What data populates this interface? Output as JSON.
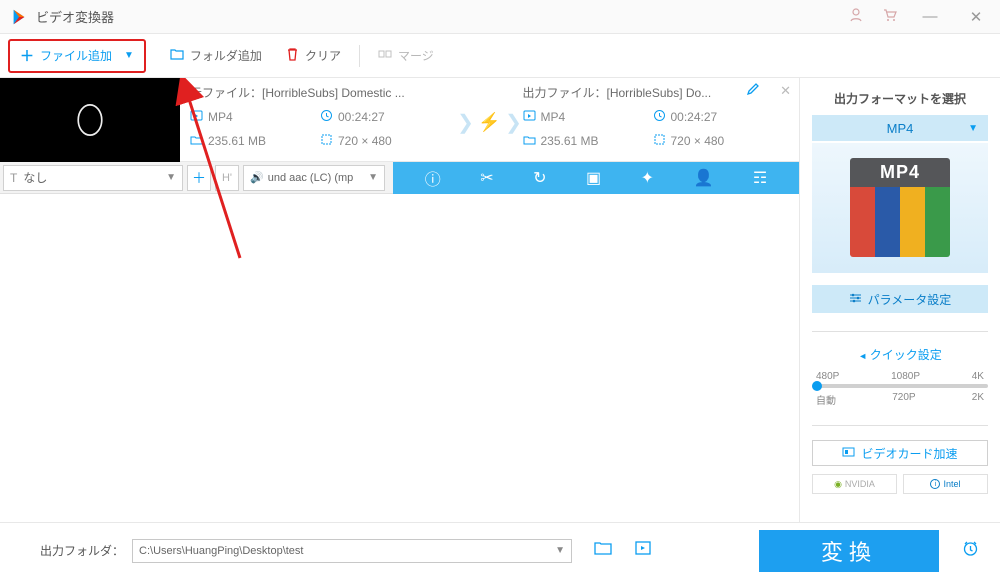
{
  "app": {
    "title": "ビデオ変換器"
  },
  "toolbar": {
    "add_file": "ファイル追加",
    "add_folder": "フォルダ追加",
    "clear": "クリア",
    "merge": "マージ"
  },
  "file": {
    "src_label": "元ファイル：[HorribleSubs] Domestic ...",
    "dst_label": "出力ファイル：[HorribleSubs] Do...",
    "src": {
      "format": "MP4",
      "duration": "00:24:27",
      "size": "235.61 MB",
      "resolution": "720 × 480"
    },
    "dst": {
      "format": "MP4",
      "duration": "00:24:27",
      "size": "235.61 MB",
      "resolution": "720 × 480"
    }
  },
  "options": {
    "subtitle": "なし",
    "audio": "und aac (LC) (mp"
  },
  "right": {
    "title": "出力フォーマットを選択",
    "format": "MP4",
    "format_badge": "MP4",
    "param_btn": "パラメータ設定",
    "quick_title": "クイック設定",
    "q_top": [
      "480P",
      "1080P",
      "4K"
    ],
    "q_bot": [
      "自動",
      "720P",
      "2K"
    ],
    "gpu_btn": "ビデオカード加速",
    "gpu_nvidia": "NVIDIA",
    "gpu_intel": "Intel"
  },
  "bottom": {
    "out_label": "出力フォルダ：",
    "out_path": "C:\\Users\\HuangPing\\Desktop\\test",
    "convert": "変換"
  }
}
